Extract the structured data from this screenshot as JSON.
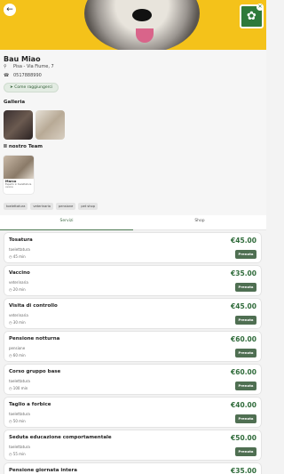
{
  "header": {
    "back_icon": "arrow-left-icon",
    "logo_icon": "paw-icon",
    "close_icon": "close-icon",
    "brand_color": "#2f7a3a",
    "hero_color": "#f4c21a"
  },
  "business": {
    "name": "Bau Miao",
    "address": "Pisa - Via Fiume, 7",
    "phone": "0517888990",
    "how_to_reach": "Come raggiungerci"
  },
  "gallery": {
    "title": "Galleria"
  },
  "team": {
    "title": "Il nostro Team",
    "members": [
      {
        "name": "Marco",
        "role": "Esperto in toelettatura canina"
      }
    ]
  },
  "categories": [
    "toelettatura",
    "veterinaria",
    "pensione",
    "pet shop"
  ],
  "tabs": [
    {
      "label": "Servizi",
      "active": true
    },
    {
      "label": "Shop",
      "active": false
    }
  ],
  "services": [
    {
      "name": "Tosatura",
      "category": "toelettatura",
      "duration": "45 min",
      "price": "€45.00",
      "action": "Prenota"
    },
    {
      "name": "Vaccino",
      "category": "veterinaria",
      "duration": "20 min",
      "price": "€35.00",
      "action": "Prenota"
    },
    {
      "name": "Visita di controllo",
      "category": "veterinaria",
      "duration": "30 min",
      "price": "€45.00",
      "action": "Prenota"
    },
    {
      "name": "Pensione notturna",
      "category": "pensione",
      "duration": "60 min",
      "price": "€60.00",
      "action": "Prenota"
    },
    {
      "name": "Corso gruppo base",
      "category": "toelettatura",
      "duration": "100 min",
      "price": "€60.00",
      "action": "Prenota"
    },
    {
      "name": "Taglio a forbice",
      "category": "toelettatura",
      "duration": "50 min",
      "price": "€40.00",
      "action": "Prenota"
    },
    {
      "name": "Seduta educazione comportamentale",
      "category": "toelettatura",
      "duration": "55 min",
      "price": "€50.00",
      "action": "Prenota"
    },
    {
      "name": "Pensione giornata intera",
      "category": "",
      "duration": "",
      "price": "€35.00",
      "action": ""
    }
  ]
}
